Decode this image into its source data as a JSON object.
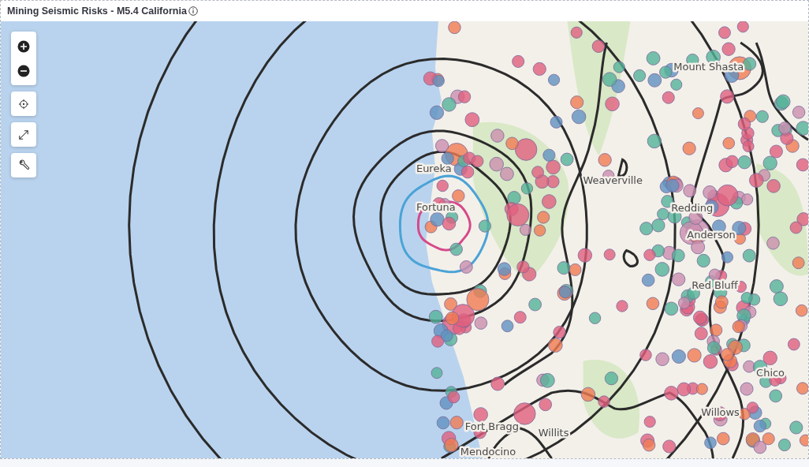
{
  "panel": {
    "title": "Mining Seismic Risks - M5.4 California"
  },
  "map": {
    "place_labels": [
      {
        "name": "Mount Shasta"
      },
      {
        "name": "Eureka"
      },
      {
        "name": "Weaverville"
      },
      {
        "name": "Fortuna"
      },
      {
        "name": "Redding"
      },
      {
        "name": "Anderson"
      },
      {
        "name": "Red Bluff"
      },
      {
        "name": "Chico"
      },
      {
        "name": "Willows"
      },
      {
        "name": "Fort Bragg"
      },
      {
        "name": "Willits"
      },
      {
        "name": "Mendocino"
      }
    ]
  }
}
